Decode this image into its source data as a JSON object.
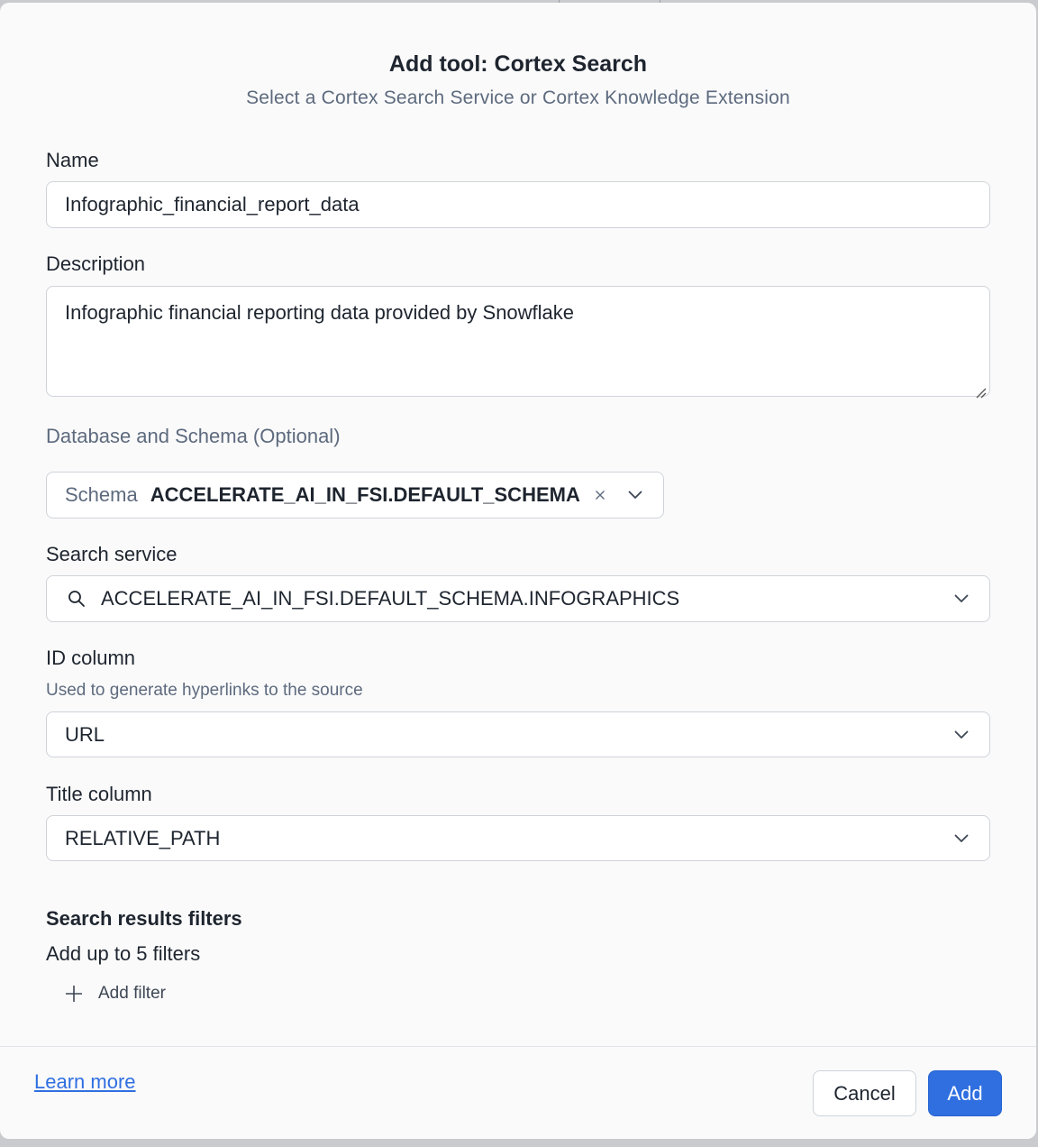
{
  "dialog": {
    "title": "Add tool: Cortex Search",
    "subtitle": "Select a Cortex Search Service or Cortex Knowledge Extension"
  },
  "name": {
    "label": "Name",
    "value": "Infographic_financial_report_data"
  },
  "description": {
    "label": "Description",
    "value": "Infographic financial reporting data provided by Snowflake"
  },
  "database_schema": {
    "label": "Database and Schema (Optional)",
    "prefix": "Schema",
    "value": "ACCELERATE_AI_IN_FSI.DEFAULT_SCHEMA"
  },
  "search_service": {
    "label": "Search service",
    "value": "ACCELERATE_AI_IN_FSI.DEFAULT_SCHEMA.INFOGRAPHICS"
  },
  "id_column": {
    "label": "ID column",
    "hint": "Used to generate hyperlinks to the source",
    "value": "URL"
  },
  "title_column": {
    "label": "Title column",
    "value": "RELATIVE_PATH"
  },
  "filters": {
    "title": "Search results filters",
    "subtitle": "Add up to 5 filters",
    "add_label": "Add filter"
  },
  "footer": {
    "learn_more": "Learn more",
    "cancel": "Cancel",
    "add": "Add"
  },
  "colors": {
    "primary": "#2f6fe0",
    "muted_text": "#5d6a7e",
    "text": "#1e252f",
    "border": "#cfd3d9"
  }
}
